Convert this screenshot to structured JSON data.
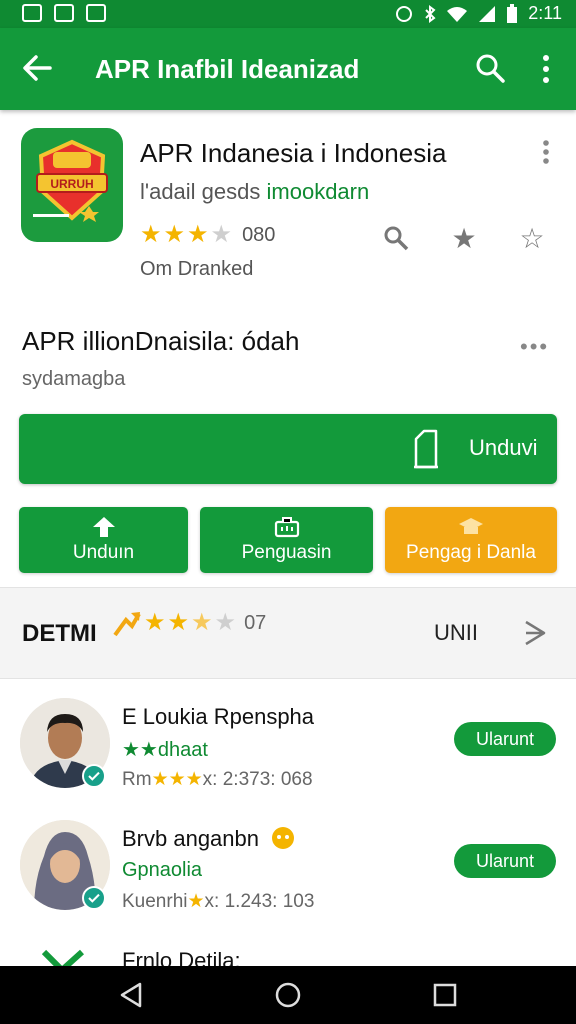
{
  "status_bar": {
    "time": "2:11",
    "icons": [
      "image-icon",
      "check-icon",
      "link-icon",
      "vibrate-icon",
      "bluetooth-icon",
      "wifi-icon",
      "signal-icon",
      "battery-icon"
    ]
  },
  "toolbar": {
    "title": "APR Inafbil Ideanizad",
    "back_icon": "arrow-left-icon",
    "search_icon": "search-icon",
    "more_icon": "more-vert-icon"
  },
  "app": {
    "name": "APR Indanesia i Indonesia",
    "subtitle_prefix": "l'adail gesds",
    "developer": "imookdarn",
    "rating_value": "080",
    "stars": 3,
    "downloads": "Om Dranked",
    "action_icons": [
      "search-icon",
      "star-icon",
      "star-outline-icon"
    ]
  },
  "section": {
    "title": "APR illionDnaisila: ódah",
    "subtitle": "sydamagba"
  },
  "install": {
    "label": "Unduvi"
  },
  "actions": [
    {
      "label": "Unduın",
      "icon": "upload-icon"
    },
    {
      "label": "Penguasin",
      "icon": "briefcase-icon"
    },
    {
      "label": "Pengag i Danla",
      "icon": "graduation-cap-icon"
    }
  ],
  "band": {
    "title": "DETMI",
    "rating_value": "07",
    "right_label": "UNII"
  },
  "reviews": [
    {
      "name": "E  Loukia Rpenspha",
      "tag": "★★dhaat",
      "meta_prefix": "Rm",
      "meta_stars": "★★★",
      "meta_value": "x: 2:373: 068",
      "button": "Ularunt"
    },
    {
      "name": "Brvb anganbn",
      "tag": "Gpnaolia",
      "meta_prefix": "Kuenrhi",
      "meta_stars": "★",
      "meta_value": "x: 1.243: 103",
      "button": "Ularunt"
    }
  ],
  "partial_row": {
    "title": "Frnlo  Detila:"
  },
  "colors": {
    "primary": "#139a3b",
    "accent_orange": "#f2a712",
    "star": "#f4b400"
  }
}
